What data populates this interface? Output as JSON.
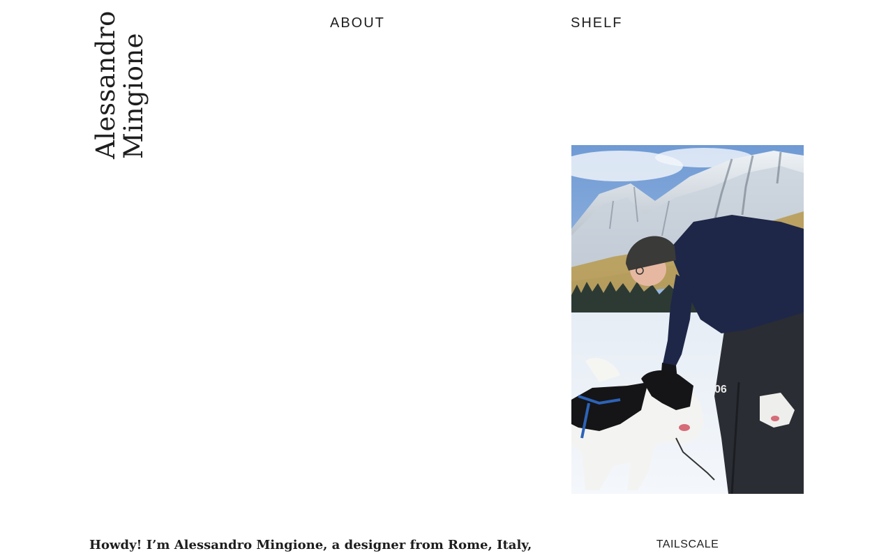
{
  "site": {
    "name_line1": "Alessandro",
    "name_line2": "Mingione"
  },
  "nav": {
    "about": "ABOUT",
    "shelf": "SHELF"
  },
  "photo": {
    "alt": "Alessandro petting sled dogs in front of snowy mountains",
    "caption": "TAILSCALE"
  },
  "intro": {
    "text": "Howdy! I’m Alessandro Mingione, a designer from Rome, Italy,"
  }
}
